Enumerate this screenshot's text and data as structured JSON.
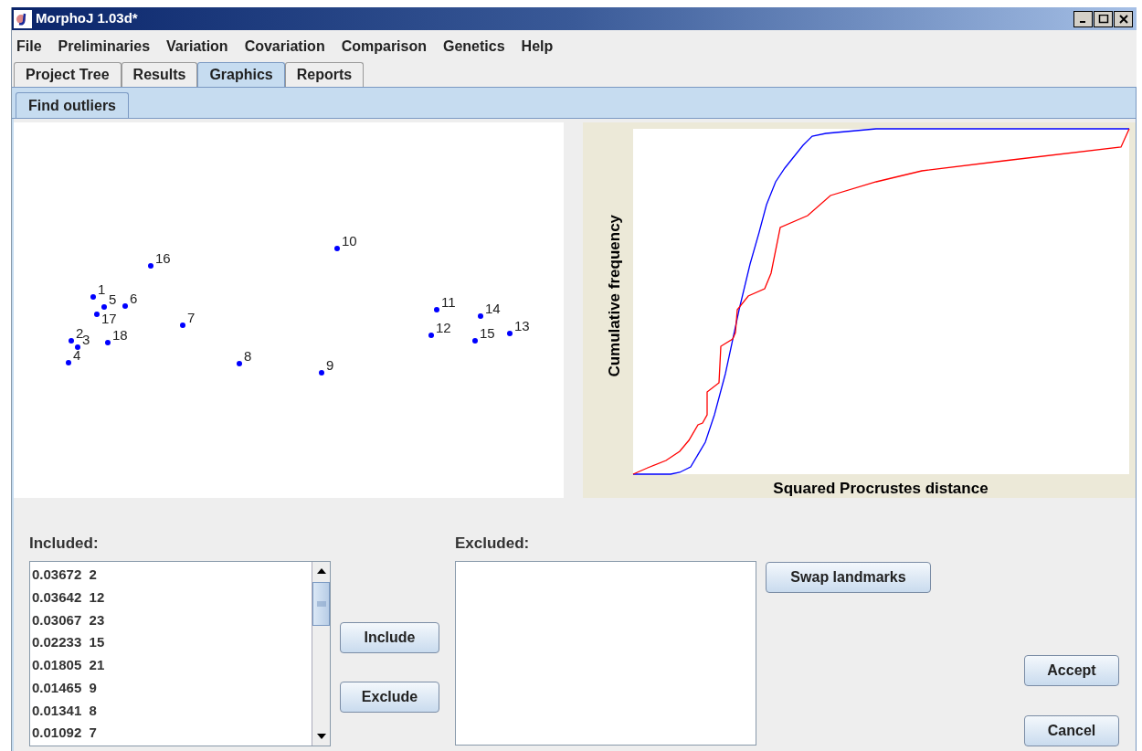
{
  "window": {
    "title": "MorphoJ 1.03d*"
  },
  "menu": [
    "File",
    "Preliminaries",
    "Variation",
    "Covariation",
    "Comparison",
    "Genetics",
    "Help"
  ],
  "tabs": [
    {
      "label": "Project Tree",
      "selected": false
    },
    {
      "label": "Results",
      "selected": false
    },
    {
      "label": "Graphics",
      "selected": true
    },
    {
      "label": "Reports",
      "selected": false
    }
  ],
  "subtabs": [
    {
      "label": "Find outliers",
      "selected": true
    }
  ],
  "landmarks": [
    "1",
    "2",
    "3",
    "4",
    "5",
    "6",
    "7",
    "8",
    "9",
    "10",
    "11",
    "12",
    "13",
    "14",
    "15",
    "16",
    "17",
    "18"
  ],
  "distribution_plot": {
    "ylabel": "Cumulative frequency",
    "xlabel": "Squared Procrustes distance"
  },
  "included": {
    "label": "Included:",
    "rows": [
      "0.03672  2",
      "0.03642  12",
      "0.03067  23",
      "0.02233  15",
      "0.01805  21",
      "0.01465  9",
      "0.01341  8",
      "0.01092  7"
    ]
  },
  "excluded": {
    "label": "Excluded:"
  },
  "buttons": {
    "include": "Include",
    "exclude": "Exclude",
    "swap": "Swap landmarks",
    "accept": "Accept",
    "cancel": "Cancel"
  }
}
